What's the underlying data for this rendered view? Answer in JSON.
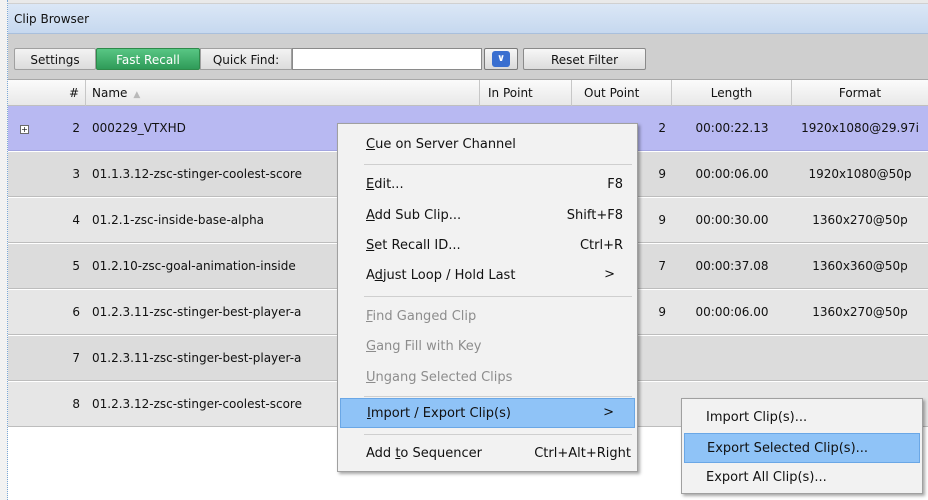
{
  "window": {
    "title": "Clip Browser"
  },
  "toolbar": {
    "settings_label": "Settings",
    "fast_recall_label": "Fast Recall",
    "quick_find_label": "Quick Find:",
    "quick_find_value": "",
    "reset_filter_label": "Reset Filter",
    "dropdown_icon": "double-chevron-down-icon"
  },
  "table": {
    "columns": {
      "num": "#",
      "name": "Name",
      "in": "In Point",
      "out": "Out Point",
      "length": "Length",
      "format": "Format"
    },
    "rows": [
      {
        "num": "2",
        "name": "000229_VTXHD",
        "out_partial": "2",
        "length": "00:00:22.13",
        "format": "1920x1080@29.97i"
      },
      {
        "num": "3",
        "name": "01.1.3.12-zsc-stinger-coolest-score",
        "out_partial": "9",
        "length": "00:00:06.00",
        "format": "1920x1080@50p"
      },
      {
        "num": "4",
        "name": "01.2.1-zsc-inside-base-alpha",
        "out_partial": "9",
        "length": "00:00:30.00",
        "format": "1360x270@50p"
      },
      {
        "num": "5",
        "name": "01.2.10-zsc-goal-animation-inside",
        "out_partial": "7",
        "length": "00:00:37.08",
        "format": "1360x360@50p"
      },
      {
        "num": "6",
        "name": "01.2.3.11-zsc-stinger-best-player-a",
        "out_partial": "9",
        "length": "00:00:06.00",
        "format": "1360x270@50p"
      },
      {
        "num": "7",
        "name": "01.2.3.11-zsc-stinger-best-player-a",
        "out_partial": "",
        "length": "",
        "format": ""
      },
      {
        "num": "8",
        "name": "01.2.3.12-zsc-stinger-coolest-score",
        "out_partial": "",
        "length": "",
        "format": ""
      }
    ]
  },
  "context_menu": {
    "cue": {
      "pre": "",
      "key": "C",
      "post": "ue on Server Channel"
    },
    "edit": {
      "pre": "",
      "key": "E",
      "post": "dit...",
      "shortcut": "F8"
    },
    "add_sub": {
      "pre": "",
      "key": "A",
      "post": "dd Sub Clip...",
      "shortcut": "Shift+F8"
    },
    "set_recall": {
      "pre": "",
      "key": "S",
      "post": "et Recall ID...",
      "shortcut": "Ctrl+R"
    },
    "adjust_loop": {
      "pre": "A",
      "key": "d",
      "post": "just Loop / Hold Last"
    },
    "find_ganged": {
      "pre": "",
      "key": "F",
      "post": "ind Ganged Clip"
    },
    "gang_fill": {
      "pre": "",
      "key": "G",
      "post": "ang Fill with Key"
    },
    "ungang": {
      "pre": "",
      "key": "U",
      "post": "ngang Selected Clips"
    },
    "import_export": {
      "pre": "",
      "key": "I",
      "post": "mport / Export Clip(s)"
    },
    "add_sequencer": {
      "pre": "Add ",
      "key": "t",
      "post": "o Sequencer",
      "shortcut": "Ctrl+Alt+Right"
    },
    "submenu_arrow": ">"
  },
  "submenu": {
    "import": "Import Clip(s)...",
    "export_selected": "Export Selected Clip(s)...",
    "export_all": "Export All Clip(s)..."
  }
}
